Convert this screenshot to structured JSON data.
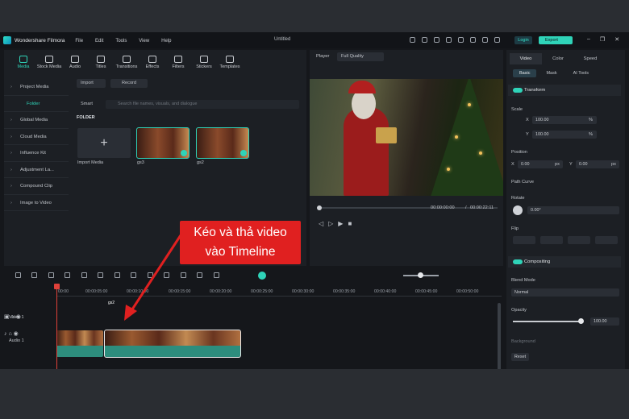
{
  "app": {
    "name": "Wondershare Filmora",
    "menu": [
      "File",
      "Edit",
      "Tools",
      "View",
      "Help"
    ],
    "project_title": "Untitled",
    "login_label": "Login",
    "export_label": "Export"
  },
  "media_tools": [
    "Media",
    "Stock Media",
    "Audio",
    "Titles",
    "Transitions",
    "Effects",
    "Filters",
    "Stickers",
    "Templates"
  ],
  "sidebar": {
    "items": [
      "Project Media",
      "Folder",
      "Global Media",
      "Cloud Media",
      "Influence Kit",
      "Adjustment La...",
      "Compound Clip",
      "Image to Video"
    ]
  },
  "library": {
    "import_label": "Import",
    "record_label": "Record",
    "sort_label": "Smart",
    "search_placeholder": "Search file names, visuals, and dialogue",
    "folder_label": "FOLDER",
    "import_media_label": "Import Media",
    "clips": [
      {
        "name": "gs3",
        "duration": "00:00:10"
      },
      {
        "name": "gs2",
        "duration": "00:00:12"
      }
    ]
  },
  "player": {
    "label": "Player",
    "quality": "Full Quality",
    "current_time": "00:00:00:00",
    "separator": "/",
    "total_time": "00:00:22:11"
  },
  "properties": {
    "tabs": [
      "Video",
      "Color",
      "Speed"
    ],
    "subtabs": [
      "Basic",
      "Mask",
      "AI Tools"
    ],
    "transform_label": "Transform",
    "scale_label": "Scale",
    "scale_x_axis": "X",
    "scale_y_axis": "Y",
    "scale_x": "100.00",
    "scale_y": "100.00",
    "percent": "%",
    "position_label": "Position",
    "pos_x_axis": "X",
    "pos_y_axis": "Y",
    "pos_x": "0.00",
    "pos_y": "0.00",
    "px": "px",
    "path_curve_label": "Path Curve",
    "rotate_label": "Rotate",
    "rotate_value": "0.00°",
    "flip_label": "Flip",
    "compositing_label": "Compositing",
    "blend_mode_label": "Blend Mode",
    "blend_mode_value": "Normal",
    "opacity_label": "Opacity",
    "opacity_value": "100.00",
    "opacity_fraction": 1.0,
    "background_label": "Background",
    "reset_label": "Reset"
  },
  "timeline": {
    "ticks": [
      "00:00",
      "00:00:05:00",
      "00:00:10:00",
      "00:00:15:00",
      "00:00:20:00",
      "00:00:25:00",
      "00:00:30:00",
      "00:00:35:00",
      "00:00:40:00",
      "00:00:45:00",
      "00:00:50:00"
    ],
    "video_track_label": "Video 1",
    "audio_track_label": "Audio 1",
    "clip_label": "gs2"
  },
  "annotation": {
    "line1": "Kéo và thả video",
    "line2": "vào Timeline",
    "color": "#e02020"
  }
}
